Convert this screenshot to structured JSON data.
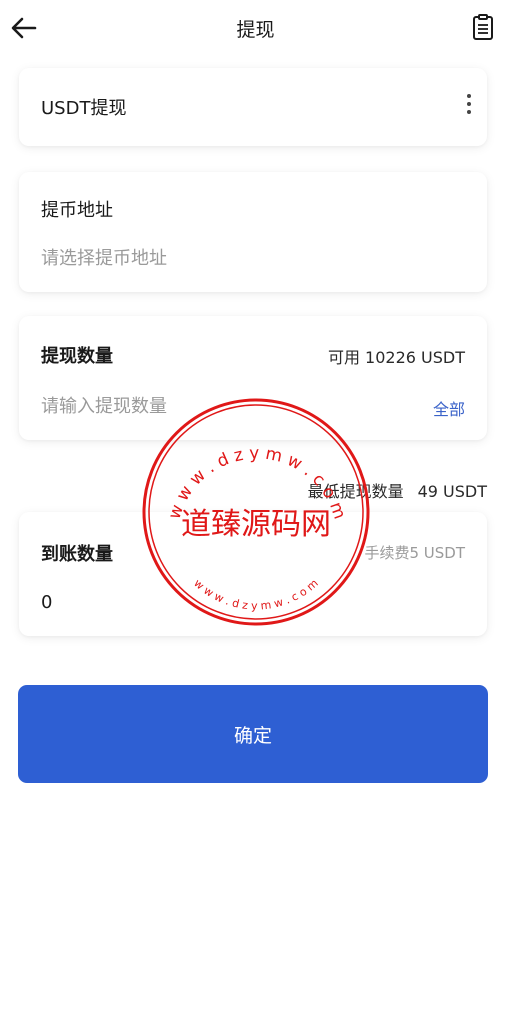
{
  "header": {
    "title": "提现",
    "back_icon": "arrow-left-icon",
    "record_icon": "clipboard-list-icon"
  },
  "coin": {
    "label": "USDT提现",
    "more_icon": "more-vertical-icon"
  },
  "address": {
    "label": "提币地址",
    "placeholder": "请选择提币地址"
  },
  "amount": {
    "label": "提现数量",
    "available": "可用 10226 USDT",
    "placeholder": "请输入提现数量",
    "all_label": "全部"
  },
  "minimum": {
    "label": "最低提现数量",
    "value": "49 USDT"
  },
  "receive": {
    "label": "到账数量",
    "fee": "手续费5 USDT",
    "value": "0"
  },
  "confirm_label": "确定",
  "watermark": {
    "main": "道臻源码网",
    "top_ring": "w w w . d z y m w . c o m",
    "bottom_ring": "w w w . d z y m w . c o m",
    "color": "#e01818"
  },
  "colors": {
    "accent": "#2e5fd3",
    "link": "#3b63c9",
    "placeholder": "#9a9a9a"
  }
}
